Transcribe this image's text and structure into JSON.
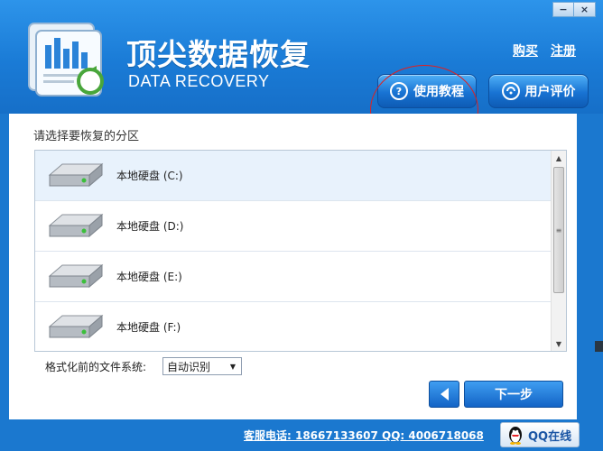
{
  "header": {
    "title": "顶尖数据恢复",
    "subtitle": "DATA RECOVERY",
    "links": [
      "购买",
      "注册"
    ],
    "tutorial_label": "使用教程",
    "review_label": "用户评价",
    "window_controls": [
      "−",
      "×"
    ]
  },
  "main": {
    "prompt": "请选择要恢复的分区",
    "partitions": [
      {
        "label": "本地硬盘 (C:)",
        "selected": true
      },
      {
        "label": "本地硬盘 (D:)",
        "selected": false
      },
      {
        "label": "本地硬盘 (E:)",
        "selected": false
      },
      {
        "label": "本地硬盘 (F:)",
        "selected": false
      }
    ],
    "fs_label": "格式化前的文件系统:",
    "fs_value": "自动识别",
    "next_label": "下一步"
  },
  "footer": {
    "contact": "客服电话: 18667133607 QQ: 4006718068",
    "qq_label": "QQ在线"
  },
  "colors": {
    "header_blue": "#1a7bd6",
    "button_blue": "#1873d3",
    "annotation_red": "#e02020"
  },
  "icons": [
    "logo-icon",
    "question-icon",
    "review-icon",
    "hard-drive-icon",
    "back-arrow-icon",
    "qq-penguin-icon"
  ]
}
